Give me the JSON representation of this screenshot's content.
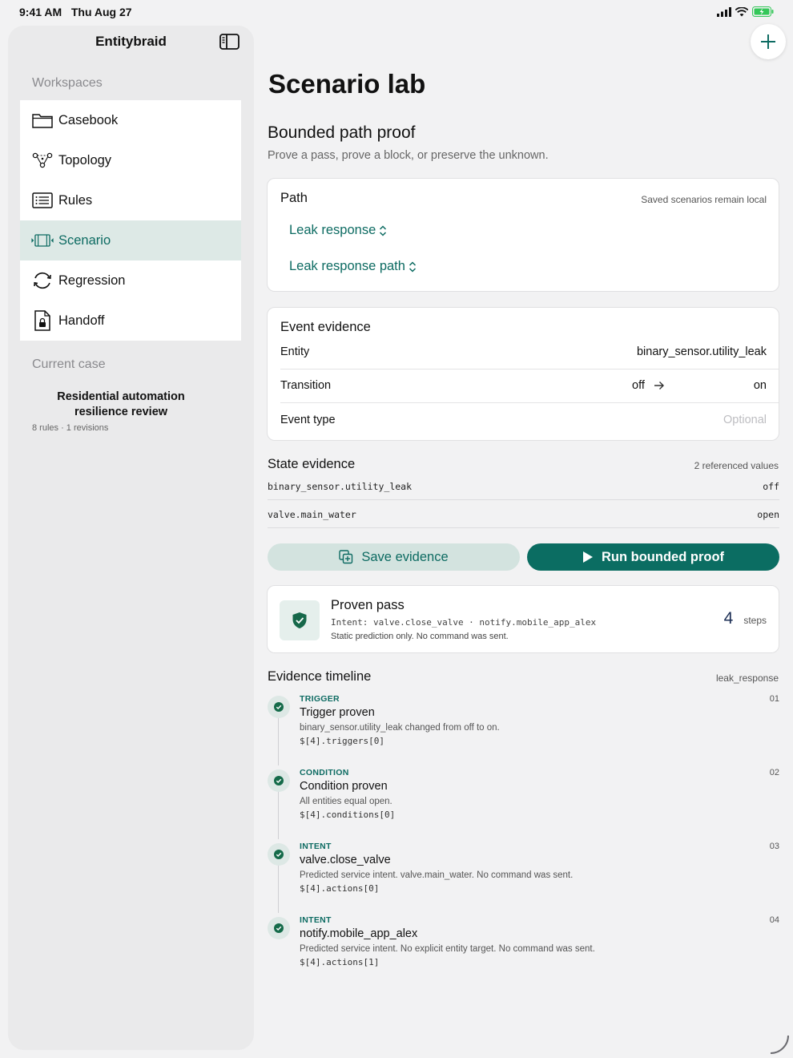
{
  "status": {
    "time": "9:41 AM",
    "date": "Thu Aug 27"
  },
  "sidebar": {
    "title": "Entitybraid",
    "workspaces_label": "Workspaces",
    "items": [
      {
        "label": "Casebook",
        "icon": "folder-icon"
      },
      {
        "label": "Topology",
        "icon": "topology-icon"
      },
      {
        "label": "Rules",
        "icon": "list-icon"
      },
      {
        "label": "Scenario",
        "icon": "film-icon",
        "active": true
      },
      {
        "label": "Regression",
        "icon": "cycle-icon"
      },
      {
        "label": "Handoff",
        "icon": "document-lock-icon"
      }
    ],
    "current_case_label": "Current case",
    "case": {
      "title": "Residential automation resilience review",
      "meta": "8 rules · 1 revisions"
    }
  },
  "main": {
    "title": "Scenario lab",
    "section_title": "Bounded path proof",
    "subtitle": "Prove a pass, prove a block, or preserve the unknown.",
    "path": {
      "label": "Path",
      "note": "Saved scenarios remain local",
      "picker_one": "Leak response",
      "picker_two": "Leak response path"
    },
    "event": {
      "label": "Event evidence",
      "entity_key": "Entity",
      "entity_value": "binary_sensor.utility_leak",
      "transition_key": "Transition",
      "transition_from": "off",
      "transition_to": "on",
      "event_type_key": "Event type",
      "event_type_placeholder": "Optional"
    },
    "state": {
      "label": "State evidence",
      "note": "2 referenced values",
      "rows": [
        {
          "entity": "binary_sensor.utility_leak",
          "value": "off"
        },
        {
          "entity": "valve.main_water",
          "value": "open"
        }
      ]
    },
    "buttons": {
      "save": "Save evidence",
      "run": "Run bounded proof"
    },
    "proof": {
      "title": "Proven pass",
      "intent": "Intent: valve.close_valve · notify.mobile_app_alex",
      "note": "Static prediction only. No command was sent.",
      "steps": "4",
      "steps_unit": "steps"
    },
    "timeline": {
      "label": "Evidence timeline",
      "note": "leak_response",
      "items": [
        {
          "kind": "TRIGGER",
          "num": "01",
          "title": "Trigger proven",
          "desc": "binary_sensor.utility_leak changed from off to on.",
          "path": "$[4].triggers[0]"
        },
        {
          "kind": "CONDITION",
          "num": "02",
          "title": "Condition proven",
          "desc": "All entities equal open.",
          "path": "$[4].conditions[0]"
        },
        {
          "kind": "INTENT",
          "num": "03",
          "title": "valve.close_valve",
          "desc": "Predicted service intent. valve.main_water. No command was sent.",
          "path": "$[4].actions[0]"
        },
        {
          "kind": "INTENT",
          "num": "04",
          "title": "notify.mobile_app_alex",
          "desc": "Predicted service intent. No explicit entity target. No command was sent.",
          "path": "$[4].actions[1]"
        }
      ]
    }
  },
  "colors": {
    "accent": "#0b6d62",
    "accent_light": "#d3e3df",
    "active_bg": "#dde9e6",
    "background": "#f2f2f3"
  }
}
